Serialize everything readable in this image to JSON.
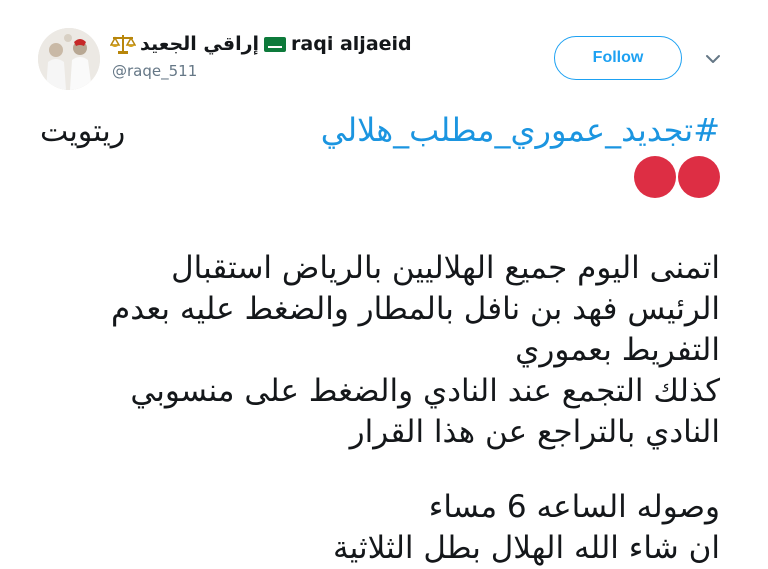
{
  "user": {
    "name_arabic": "إراقي الجعيد",
    "name_latin": "raqi aljaeid",
    "handle": "@raqe_511",
    "follow_label": "Follow"
  },
  "tweet": {
    "hashtag": "#تجديد_عموري_مطلب_هلالي",
    "retweet": "ريتويت",
    "lines": [
      "اتمنى اليوم جميع الهلاليين بالرياض استقبال",
      "الرئيس فهد بن نافل بالمطار والضغط عليه بعدم",
      "التفريط بعموري",
      "كذلك التجمع عند النادي والضغط على منسوبي",
      "النادي بالتراجع عن هذا القرار"
    ],
    "time_line": "وصوله الساعه 6 مساء",
    "cutoff_line": "ان شاء الله الهلال بطل الثلاثية"
  },
  "icons": {
    "emoji": "red-circle",
    "flag": "saudi-flag-icon",
    "badge": "scales-icon",
    "menu": "chevron-down-icon"
  },
  "colors": {
    "accent": "#1da1f2",
    "hashtag": "#1b95e0",
    "emoji_red": "#dd2e44",
    "muted": "#657786"
  }
}
